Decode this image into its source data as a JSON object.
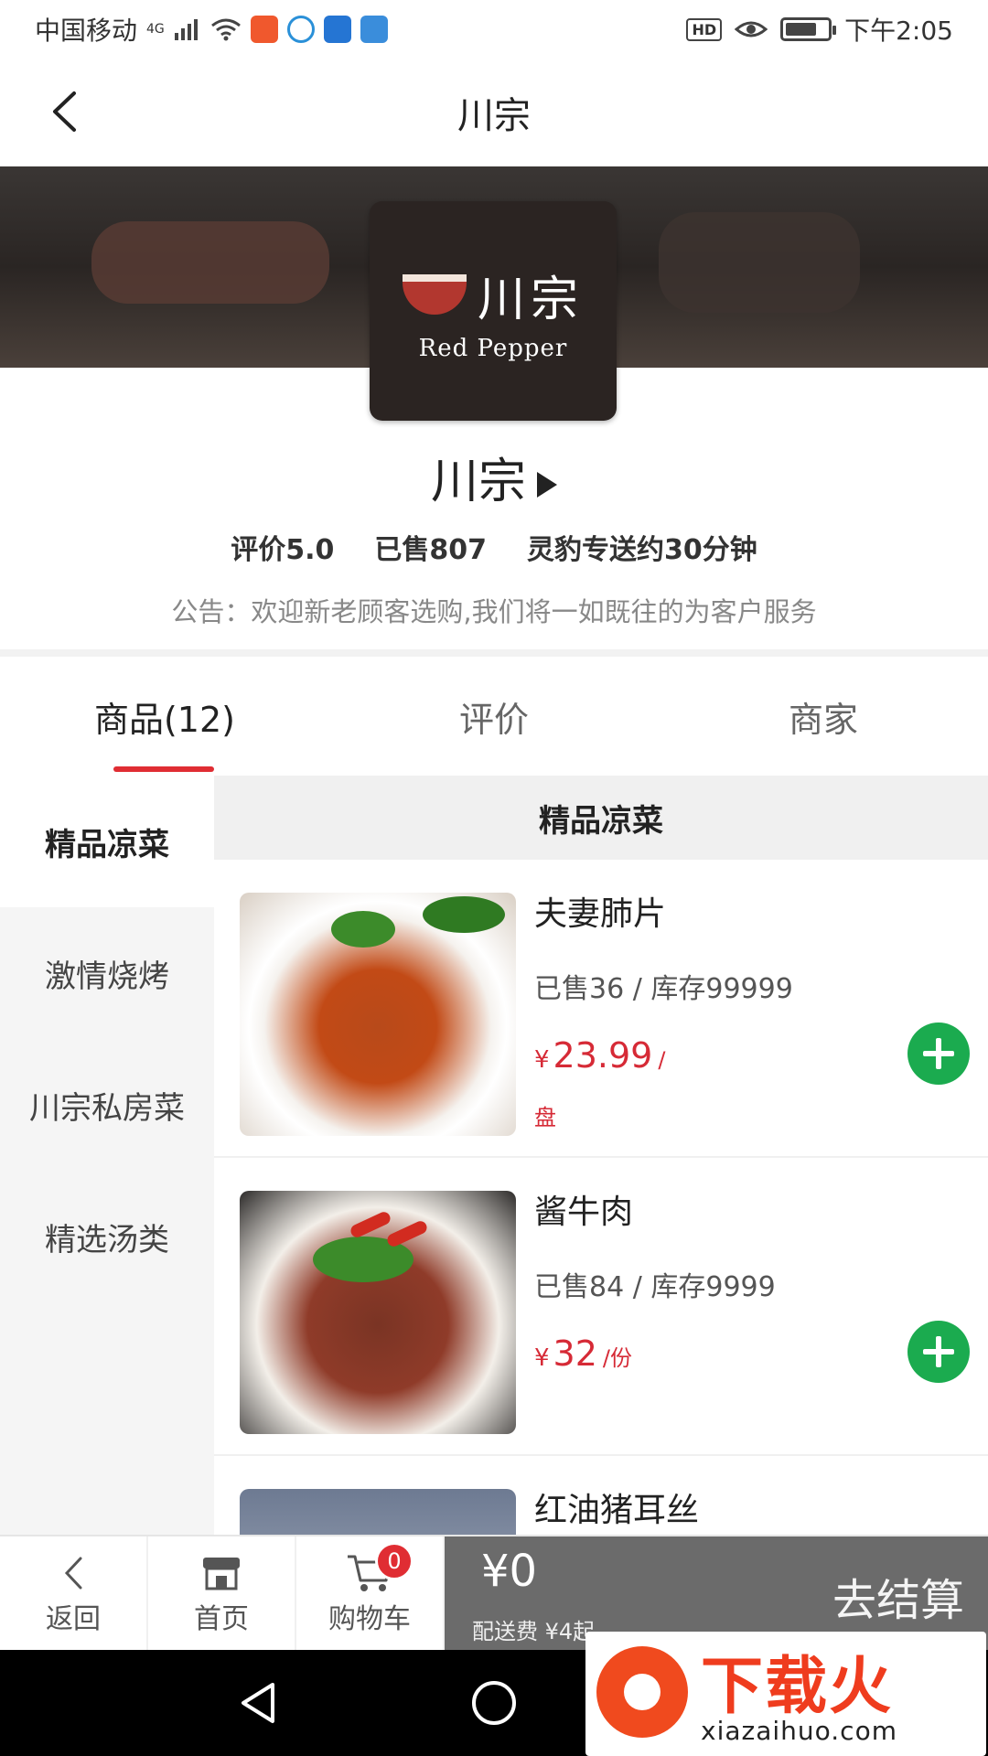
{
  "status_bar": {
    "carrier": "中国移动",
    "network": "4G",
    "hd": "HD",
    "time": "下午2:05",
    "battery_level": 0.75
  },
  "nav": {
    "title": "川宗"
  },
  "shop": {
    "logo_cn": "川宗",
    "logo_en": "Red Pepper",
    "name": "川宗",
    "rating": "评价5.0",
    "sold": "已售807",
    "delivery": "灵豹专送约30分钟",
    "notice": "公告：欢迎新老顾客选购,我们将一如既往的为客户服务"
  },
  "tabs": [
    {
      "label": "商品(12)",
      "active": true
    },
    {
      "label": "评价",
      "active": false
    },
    {
      "label": "商家",
      "active": false
    }
  ],
  "categories": [
    {
      "label": "精品凉菜",
      "active": true
    },
    {
      "label": "激情烧烤",
      "active": false
    },
    {
      "label": "川宗私房菜",
      "active": false
    },
    {
      "label": "精选汤类",
      "active": false
    }
  ],
  "section_title": "精品凉菜",
  "products": [
    {
      "name": "夫妻肺片",
      "sales": "已售36 / 库存99999",
      "currency": "¥",
      "price": "23.99",
      "unit_sep": "/",
      "unit": "盘"
    },
    {
      "name": "酱牛肉",
      "sales": "已售84 / 库存9999",
      "currency": "¥",
      "price": "32",
      "unit": "/份"
    },
    {
      "name": "红油猪耳丝"
    }
  ],
  "bottom_bar": {
    "back_label": "返回",
    "home_label": "首页",
    "cart_label": "购物车",
    "cart_count": "0",
    "total": "¥0",
    "delivery_fee": "配送费 ¥4起",
    "checkout_label": "去结算"
  },
  "watermark": {
    "text": "下载火",
    "url": "xiazaihuo.com"
  },
  "colors": {
    "accent": "#e02d33",
    "price": "#d62a36",
    "add_button": "#1bab4f",
    "checkout_bg": "#6b6b6b"
  }
}
